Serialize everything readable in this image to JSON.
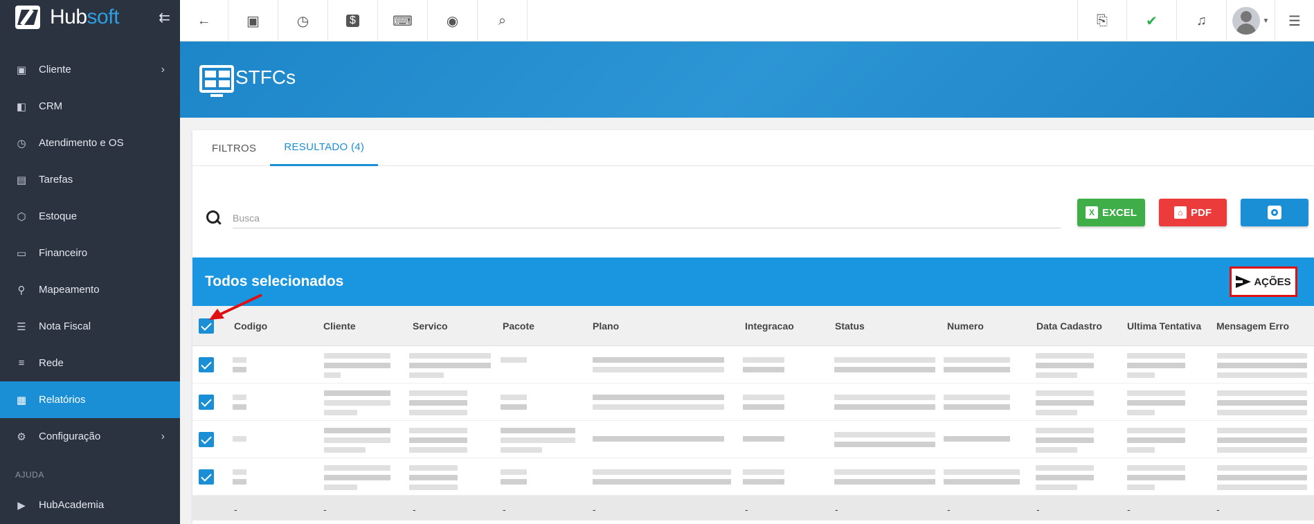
{
  "brand": {
    "hub": "Hub",
    "soft": "soft"
  },
  "sidebar": {
    "items": [
      {
        "label": "Cliente",
        "icon": "id-card-icon",
        "chevron": true
      },
      {
        "label": "CRM",
        "icon": "board-icon",
        "chevron": false
      },
      {
        "label": "Atendimento e OS",
        "icon": "calendar-clock-icon",
        "chevron": false
      },
      {
        "label": "Tarefas",
        "icon": "task-icon",
        "chevron": false
      },
      {
        "label": "Estoque",
        "icon": "box-icon",
        "chevron": false
      },
      {
        "label": "Financeiro",
        "icon": "money-icon",
        "chevron": false
      },
      {
        "label": "Mapeamento",
        "icon": "map-pin-icon",
        "chevron": false
      },
      {
        "label": "Nota Fiscal",
        "icon": "document-icon",
        "chevron": false
      },
      {
        "label": "Rede",
        "icon": "server-icon",
        "chevron": false
      },
      {
        "label": "Relatórios",
        "icon": "report-icon",
        "chevron": false,
        "active": true
      },
      {
        "label": "Configuração",
        "icon": "gear-icon",
        "chevron": true
      }
    ],
    "section_label": "AJUDA",
    "help_item": {
      "label": "HubAcademia",
      "icon": "youtube-icon"
    }
  },
  "topbar": {
    "buttons": [
      "back-arrow-icon",
      "contact-icon",
      "calendar-clock-icon",
      "dollar-icon",
      "terminal-icon",
      "eye-icon",
      "search-icon"
    ],
    "right_buttons": [
      "pdf-icon",
      "chat-check-icon",
      "bell-icon"
    ]
  },
  "page": {
    "title": "STFCs"
  },
  "tabs": [
    {
      "label": "FILTROS",
      "active": false
    },
    {
      "label": "RESULTADO (4)",
      "active": true
    }
  ],
  "search": {
    "placeholder": "Busca",
    "value": ""
  },
  "actions": {
    "excel": "EXCEL",
    "pdf": "PDF"
  },
  "selection": {
    "title": "Todos selecionados",
    "acoes_label": "AÇÕES"
  },
  "table": {
    "columns": [
      "Codigo",
      "Cliente",
      "Servico",
      "Pacote",
      "Plano",
      "Integracao",
      "Status",
      "Numero",
      "Data Cadastro",
      "Ultima Tentativa",
      "Mensagem Erro"
    ],
    "row_count": 4,
    "footer_dash": "-"
  },
  "colors": {
    "primary": "#1a8fd6",
    "excel": "#3fae49",
    "pdf": "#ec3b3b",
    "sidebar": "#2b3240",
    "highlight": "#e01010"
  }
}
